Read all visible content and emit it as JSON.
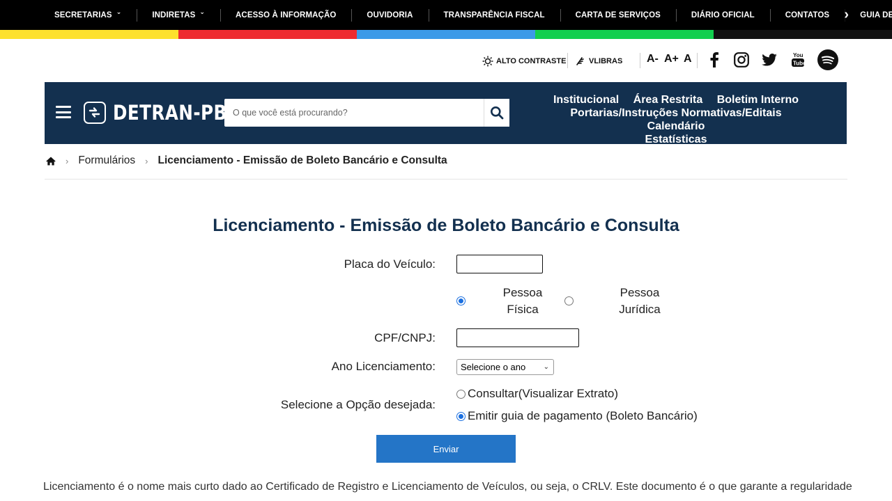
{
  "topbar": {
    "items": [
      {
        "label": "SECRETARIAS",
        "dropdown": true
      },
      {
        "label": "INDIRETAS",
        "dropdown": true
      },
      {
        "label": "ACESSO À INFORMAÇÃO"
      },
      {
        "label": "OUVIDORIA"
      },
      {
        "label": "TRANSPARÊNCIA FISCAL"
      },
      {
        "label": "CARTA DE SERVIÇOS"
      },
      {
        "label": "DIÁRIO OFICIAL"
      },
      {
        "label": "CONTATOS"
      },
      {
        "label": "GUIA DE"
      }
    ],
    "next_icon": "chevron-right-icon"
  },
  "stripe_colors": [
    "#fde12d",
    "#ee2b30",
    "#3b9ae8",
    "#12cf4f",
    "#111111"
  ],
  "accessibility": {
    "contrast_label": "ALTO CONTRASTE",
    "libras_label": "VLIBRAS",
    "font_decrease": "A-",
    "font_increase": "A+",
    "font_reset": "A",
    "socials": [
      "facebook-icon",
      "instagram-icon",
      "twitter-icon",
      "youtube-icon",
      "spotify-icon"
    ]
  },
  "header": {
    "logo_text": "DETRAN-PB",
    "search_placeholder": "O que você está procurando?",
    "nav_row1": [
      "Institucional",
      "Área Restrita",
      "Boletim Interno"
    ],
    "nav_row2": [
      "Portarias/Instruções Normativas/Editais",
      "Calendário"
    ],
    "nav_row3": [
      "Estatísticas"
    ],
    "brand_color": "#13304f"
  },
  "breadcrumb": {
    "home_icon": "home-icon",
    "items": [
      "Formulários",
      "Licenciamento - Emissão de Boleto Bancário e Consulta"
    ]
  },
  "form": {
    "title": "Licenciamento - Emissão de Boleto Bancário e Consulta",
    "plate_label": "Placa do Veículo:",
    "plate_value": "",
    "person_type": {
      "options": [
        {
          "line1": "Pessoa",
          "line2": "Física",
          "selected": true
        },
        {
          "line1": "Pessoa",
          "line2": "Jurídica",
          "selected": false
        }
      ]
    },
    "doc_label": "CPF/CNPJ:",
    "doc_value": "",
    "year_label": "Ano Licenciamento:",
    "year_selected": "Selecione o ano",
    "option_label": "Selecione a Opção desejada:",
    "options": [
      {
        "label": "Consultar(Visualizar Extrato)",
        "selected": false
      },
      {
        "label": "Emitir guia de pagamento (Boleto Bancário)",
        "selected": true
      }
    ],
    "submit_label": "Enviar",
    "submit_color": "#2475c7"
  },
  "description": "Licenciamento é o nome mais curto dado ao Certificado de Registro e Licenciamento de Veículos, ou seja, o CRLV. Este documento é o que garante a regularidade"
}
